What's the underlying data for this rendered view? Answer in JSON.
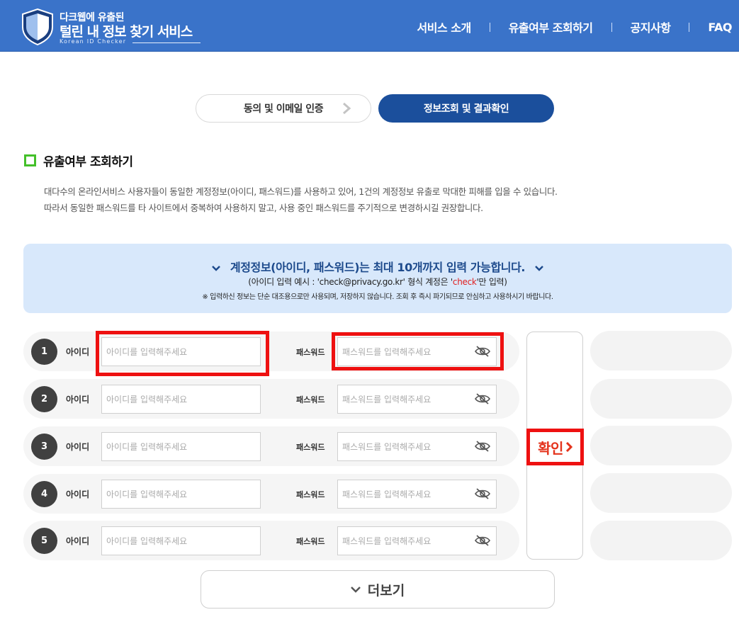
{
  "brand": {
    "line1": "다크웹에 유출된",
    "line2": "털린 내 정보 찾기 서비스",
    "line3": "Korean ID Checker"
  },
  "nav": {
    "items": [
      "서비스 소개",
      "유출여부 조회하기",
      "공지사항",
      "FAQ"
    ]
  },
  "steps": {
    "step1": "동의 및 이메일 인증",
    "step2": "정보조회 및 결과확인"
  },
  "section": {
    "title": "유출여부 조회하기",
    "desc_line1": "대다수의 온라인서비스 사용자들이 동일한 계정정보(아이디, 패스워드)를 사용하고 있어, 1건의 계정정보 유출로 막대한 피해를 입을 수 있습니다.",
    "desc_line2": "따라서 동일한 패스워드를 타 사이트에서 중복하여 사용하지 말고, 사용 중인 패스워드를 주기적으로 변경하시길 권장합니다."
  },
  "banner": {
    "main": "계정정보(아이디, 패스워드)는 최대 10개까지 입력 가능합니다.",
    "example_prefix": "(아이디 입력 예시 : 'check@privacy.go.kr' 형식 계정은 '",
    "example_red": "check",
    "example_suffix": "'만 입력)",
    "note": "※ 입력하신 정보는 단순 대조용으로만 사용되며, 저장하지 않습니다. 조회 후 즉시 파기되므로 안심하고 사용하시기 바랍니다."
  },
  "form": {
    "id_label": "아이디",
    "pw_label": "패스워드",
    "id_placeholder": "아이디를 입력해주세요",
    "pw_placeholder": "패스워드를 입력해주세요",
    "rows": [
      "1",
      "2",
      "3",
      "4",
      "5"
    ]
  },
  "confirm_label": "확인",
  "more_label": "더보기",
  "colors": {
    "header": "#3a73c9",
    "active_step": "#1b4f9c",
    "highlight": "#ee1111",
    "accent_red": "#e4331c",
    "section_box": "#44c02a"
  }
}
